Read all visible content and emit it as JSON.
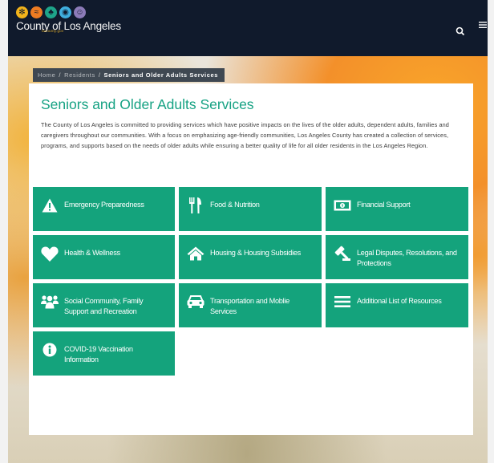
{
  "header": {
    "logo_title": "County of Los Angeles",
    "logo_url": "lacounty.gov"
  },
  "breadcrumb": {
    "items": [
      "Home",
      "Residents"
    ],
    "current": "Seniors and Older Adults Services"
  },
  "main": {
    "title": "Seniors and Older Adults Services",
    "intro": "The County of Los Angeles is committed to providing services which have positive impacts on the lives of the older adults, dependent adults, families and caregivers throughout our communities. With a focus on emphasizing age-friendly communities, Los Angeles County has created a collection of services, programs, and supports based on the needs of older adults while ensuring a better quality of life for all older residents in the Los Angeles Region.",
    "tiles": [
      {
        "label": "Emergency Preparedness",
        "icon": "warning-icon"
      },
      {
        "label": "Food & Nutrition",
        "icon": "utensils-icon"
      },
      {
        "label": "Financial Support",
        "icon": "money-bill-icon"
      },
      {
        "label": "Health & Wellness",
        "icon": "heart-icon"
      },
      {
        "label": "Housing & Housing Subsidies",
        "icon": "home-icon"
      },
      {
        "label": "Legal Disputes, Resolutions, and Protections",
        "icon": "gavel-icon"
      },
      {
        "label": "Social Community, Family Support and Recreation",
        "icon": "users-icon"
      },
      {
        "label": "Transportation and Moblie Services",
        "icon": "car-icon"
      },
      {
        "label": "Additional List of Resources",
        "icon": "list-icon"
      },
      {
        "label": "COVID-19 Vaccination Information",
        "icon": "info-circle-icon"
      }
    ]
  },
  "colors": {
    "header_bg": "#101a2c",
    "accent_green": "#14a37c",
    "title_green": "#16a283",
    "breadcrumb_bg": "#3f4852"
  }
}
